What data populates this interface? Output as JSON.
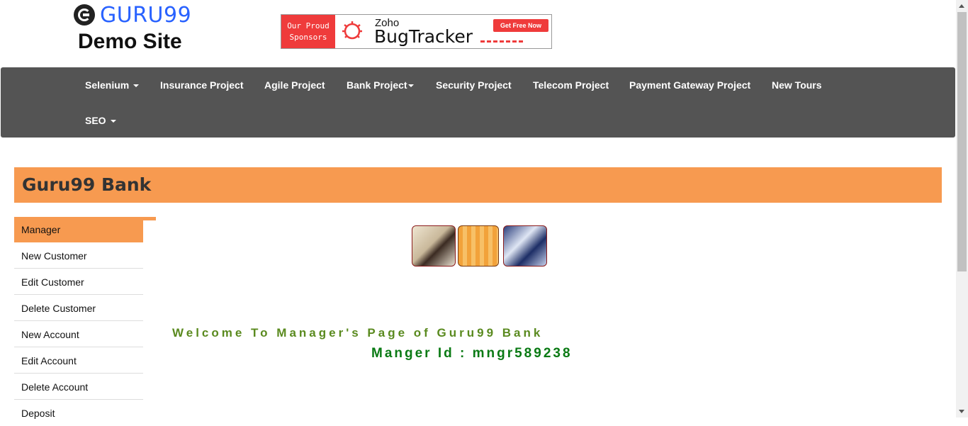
{
  "logo": {
    "brand": "GURU99",
    "subtitle": "Demo Site"
  },
  "banner": {
    "left_line1": "Our Proud",
    "left_line2": "Sponsors",
    "brand": "Zoho",
    "product": "BugTracker",
    "cta": "Get Free Now"
  },
  "nav": {
    "selenium": "Selenium",
    "insurance": "Insurance Project",
    "agile": "Agile Project",
    "bank": "Bank Project",
    "security": "Security Project",
    "telecom": "Telecom Project",
    "payment": "Payment Gateway Project",
    "newtours": "New Tours",
    "seo": "SEO"
  },
  "bank": {
    "title": "Guru99 Bank"
  },
  "sidebar": {
    "items": [
      {
        "label": "Manager"
      },
      {
        "label": "New Customer"
      },
      {
        "label": "Edit Customer"
      },
      {
        "label": "Delete Customer"
      },
      {
        "label": "New Account"
      },
      {
        "label": "Edit Account"
      },
      {
        "label": "Delete Account"
      },
      {
        "label": "Deposit"
      }
    ]
  },
  "main": {
    "welcome": "Welcome To Manager's Page of Guru99 Bank",
    "manager_id": "Manger Id : mngr589238"
  },
  "colors": {
    "accent": "#f79a50",
    "nav_bg": "#545454",
    "welcome_text": "#5a8a1f",
    "manager_id_text": "#0a7a14",
    "logo_blue": "#2962ff"
  }
}
